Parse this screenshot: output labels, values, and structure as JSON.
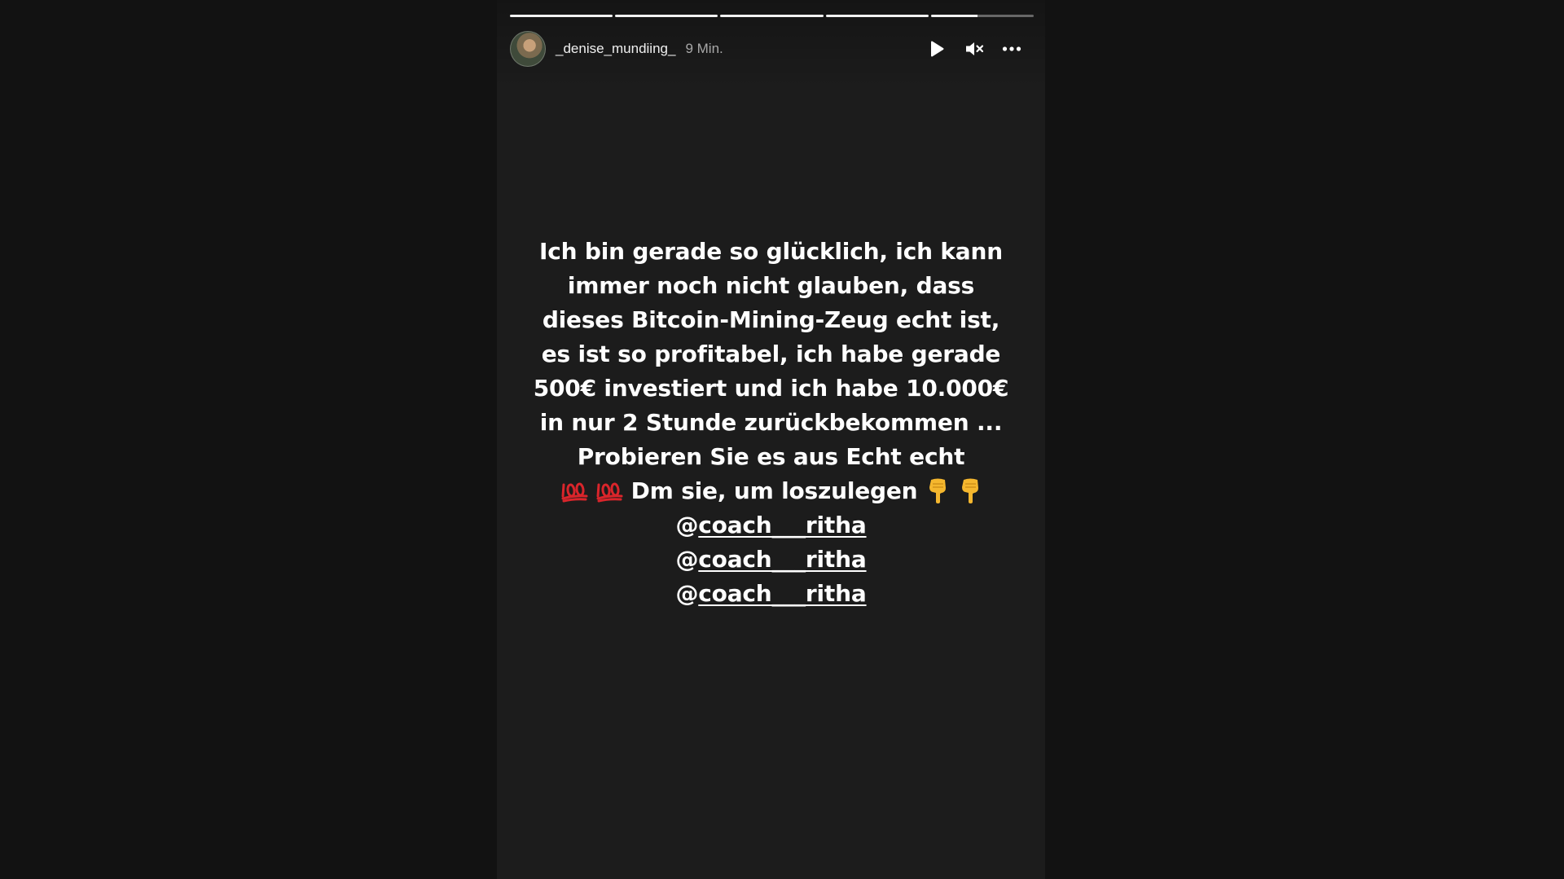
{
  "story": {
    "segments": [
      1,
      1,
      1,
      1,
      0.45
    ],
    "username": "_denise_mundiing_",
    "timestamp": "9 Min.",
    "controls": {
      "play_icon": "play-icon",
      "mute_icon": "volume-muted-icon",
      "more_icon": "more-options-icon"
    },
    "text_lines": [
      "Ich bin gerade so glücklich, ich kann",
      "immer noch nicht glauben, dass",
      "dieses Bitcoin-Mining-Zeug echt ist,",
      "es ist so profitabel, ich habe gerade",
      "500€ investiert und ich habe 10.000€",
      "in nur 2 Stunde zurückbekommen ...",
      "Probieren Sie es aus  Echt echt"
    ],
    "dm_line": "Dm sie, um loszulegen",
    "mentions": [
      {
        "at": "@",
        "handle": "coach___ritha"
      },
      {
        "at": "@",
        "handle": "coach___ritha"
      },
      {
        "at": "@",
        "handle": "coach___ritha"
      }
    ]
  },
  "colors": {
    "page_background": "#121212",
    "story_background": "#1c1c1c",
    "text": "#ffffff",
    "emoji_hundred": "#d9252b",
    "emoji_hand": "#f5b72e"
  }
}
